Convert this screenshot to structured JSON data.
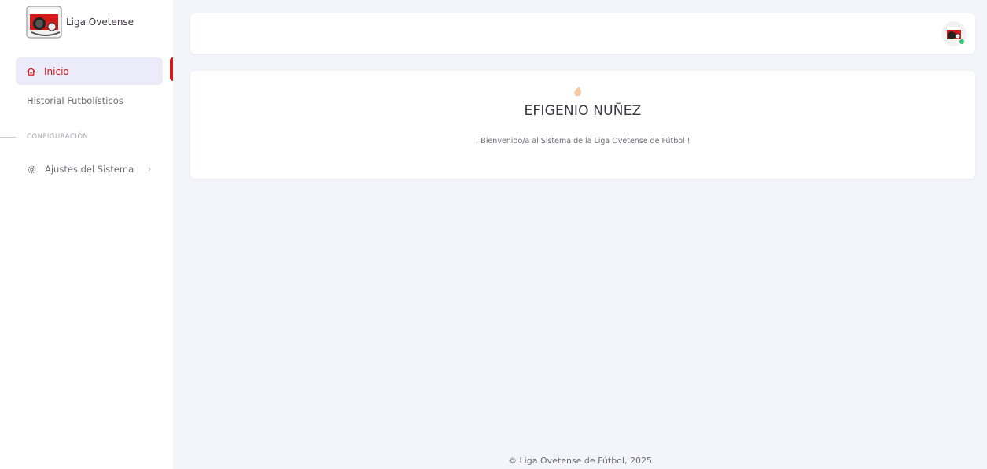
{
  "sidebar": {
    "brand_name": "Liga Ovetense",
    "nav_active": {
      "label": "Inicio",
      "icon": "home-icon"
    },
    "nav_items": [
      {
        "label": "Historial Futbolísticos"
      }
    ],
    "section_header": "CONFIGURACIÓN",
    "settings_item": {
      "label": "Ajustes del Sistema",
      "icon": "gear-icon",
      "chevron": "›"
    }
  },
  "welcome": {
    "emoji": "👋",
    "user_name": "EFIGENIO NUÑEZ",
    "message": "¡ Bienvenido/a al Sistema de la Liga Ovetense de Fútbol !"
  },
  "footer": {
    "text": "© Liga Ovetense de Fútbol, 2025"
  },
  "colors": {
    "accent": "#d11b1b",
    "active_bg": "#ebebf9",
    "page_bg": "#f4f5fa",
    "online": "#28c76f"
  }
}
